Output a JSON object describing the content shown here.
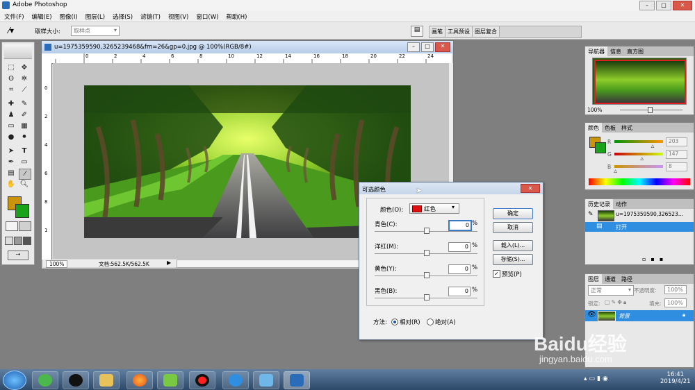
{
  "app": {
    "title": "Adobe Photoshop"
  },
  "window_controls": {
    "minimize": "–",
    "maximize": "□",
    "close": "✕"
  },
  "menu": [
    "文件(F)",
    "编辑(E)",
    "图像(I)",
    "图层(L)",
    "选择(S)",
    "滤镜(T)",
    "视图(V)",
    "窗口(W)",
    "帮助(H)"
  ],
  "options": {
    "sample_size_label": "取样大小:",
    "sample_size_value": "取样点"
  },
  "palette_well": [
    "画笔",
    "工具预设",
    "图层复合"
  ],
  "document": {
    "title": "u=1975359590,3265239468&fm=26&gp=0.jpg @ 100%(RGB/8#)",
    "zoom": "100%",
    "doc_info": "文档:562.5K/562.5K",
    "ruler_h": [
      "0",
      "2",
      "4",
      "6",
      "8",
      "10",
      "12",
      "14",
      "16",
      "18",
      "20",
      "22",
      "24"
    ],
    "ruler_v": [
      "0",
      "2",
      "4",
      "6",
      "8",
      "1"
    ]
  },
  "navigator": {
    "tabs": [
      "导航器",
      "信息",
      "直方图"
    ],
    "zoom": "100%"
  },
  "color_panel": {
    "tabs": [
      "颜色",
      "色板",
      "样式"
    ],
    "labels": [
      "R",
      "G",
      "B"
    ],
    "values": [
      "203",
      "147",
      "8"
    ],
    "r": 203,
    "g": 147,
    "b": 8,
    "fg_color": "#cb9308",
    "bg_color": "#1aa31a"
  },
  "history": {
    "tabs": [
      "历史记录",
      "动作"
    ],
    "snapshot": "u=1975359590,326523...",
    "step": "打开"
  },
  "layers": {
    "tabs": [
      "图层",
      "通道",
      "路径"
    ],
    "blend": "正常",
    "opacity_label": "不透明度:",
    "opacity": "100%",
    "lock_label": "锁定:",
    "fill_label": "填充:",
    "fill": "100%",
    "layer_name": "背景"
  },
  "dialog": {
    "title": "可选颜色",
    "color_label": "颜色(O):",
    "color_value": "红色",
    "rows": [
      {
        "label": "青色(C):",
        "value": "0",
        "unit": "%"
      },
      {
        "label": "洋红(M):",
        "value": "0",
        "unit": "%"
      },
      {
        "label": "黄色(Y):",
        "value": "0",
        "unit": "%"
      },
      {
        "label": "黑色(B):",
        "value": "0",
        "unit": "%"
      }
    ],
    "buttons": {
      "ok": "确定",
      "cancel": "取消",
      "load": "载入(L)...",
      "save": "存储(S)..."
    },
    "preview_label": "预览(P)",
    "method_label": "方法:",
    "relative": "相对(R)",
    "absolute": "绝对(A)"
  },
  "watermark": {
    "brand": "Baidu经验",
    "url": "jingyan.baidu.com"
  },
  "taskbar": {
    "time": "16:41",
    "date": "2019/4/21"
  }
}
